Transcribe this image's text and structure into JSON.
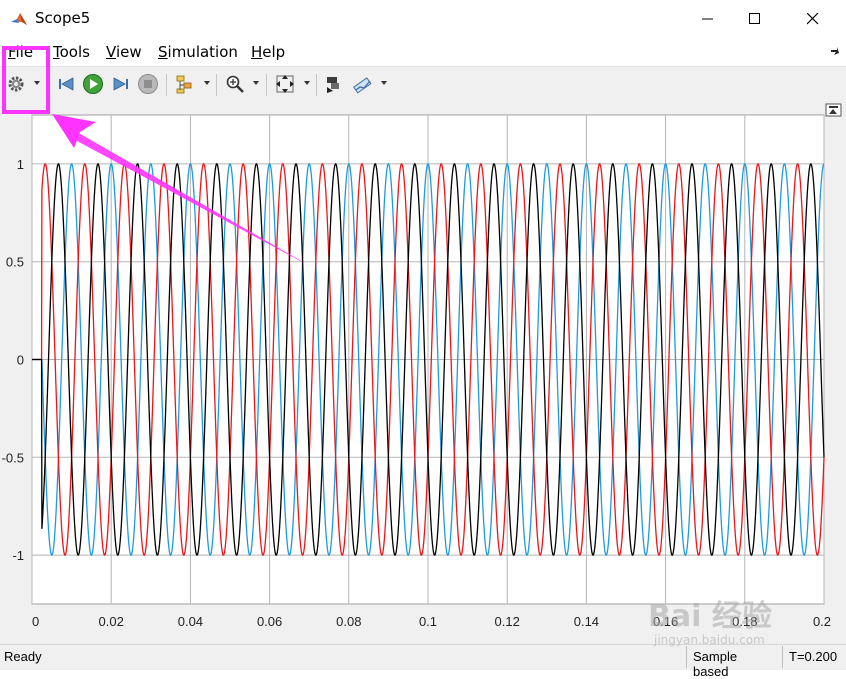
{
  "window": {
    "title": "Scope5"
  },
  "menu": {
    "items": [
      {
        "prefix": "",
        "mnemonic": "F",
        "rest": "ile"
      },
      {
        "prefix": "",
        "mnemonic": "T",
        "rest": "ools"
      },
      {
        "prefix": "",
        "mnemonic": "V",
        "rest": "iew"
      },
      {
        "prefix": "",
        "mnemonic": "S",
        "rest": "imulation"
      },
      {
        "prefix": "",
        "mnemonic": "H",
        "rest": "elp"
      }
    ]
  },
  "toolbar": {
    "icons": [
      "settings-gear-icon",
      "step-back-icon",
      "run-icon",
      "step-forward-icon",
      "stop-icon",
      "signal-hierarchy-icon",
      "zoom-icon",
      "fit-axes-icon",
      "highlight-block-icon",
      "style-icon"
    ]
  },
  "status": {
    "left": "Ready",
    "mode": "Sample based",
    "time": "T=0.200"
  },
  "colors": {
    "annotation": "#ff33ff",
    "series1": "#1f9bdc",
    "series2": "#e8171b",
    "series3": "#000000"
  },
  "chart_data": {
    "type": "line",
    "title": "",
    "xlabel": "",
    "ylabel": "",
    "xlim": [
      0,
      0.2
    ],
    "ylim": [
      -1.25,
      1.25
    ],
    "grid": true,
    "x_ticks": [
      0,
      0.02,
      0.04,
      0.06,
      0.08,
      0.1,
      0.12,
      0.14,
      0.16,
      0.18,
      0.2
    ],
    "x_tick_labels": [
      "0",
      "0.02",
      "0.04",
      "0.06",
      "0.08",
      "0.1",
      "0.12",
      "0.14",
      "0.16",
      "0.18",
      "0.2"
    ],
    "y_ticks": [
      1,
      0.5,
      0,
      -0.5,
      -1
    ],
    "y_tick_labels": [
      "1",
      "0.5",
      "0",
      "-0.5",
      "-1"
    ],
    "series": [
      {
        "color": "#1f9bdc",
        "frequency_hz": 100,
        "amplitude": 1,
        "phase_deg": 90,
        "start_time": 0.0025
      },
      {
        "color": "#e8171b",
        "frequency_hz": 100,
        "amplitude": 1,
        "phase_deg": -30,
        "start_time": 0.0025
      },
      {
        "color": "#000000",
        "frequency_hz": 100,
        "amplitude": 1,
        "phase_deg": 210,
        "start_time": 0.0025
      }
    ]
  },
  "watermark": {
    "text": "Bai 经验",
    "subtext": "jingyan.baidu.com"
  }
}
